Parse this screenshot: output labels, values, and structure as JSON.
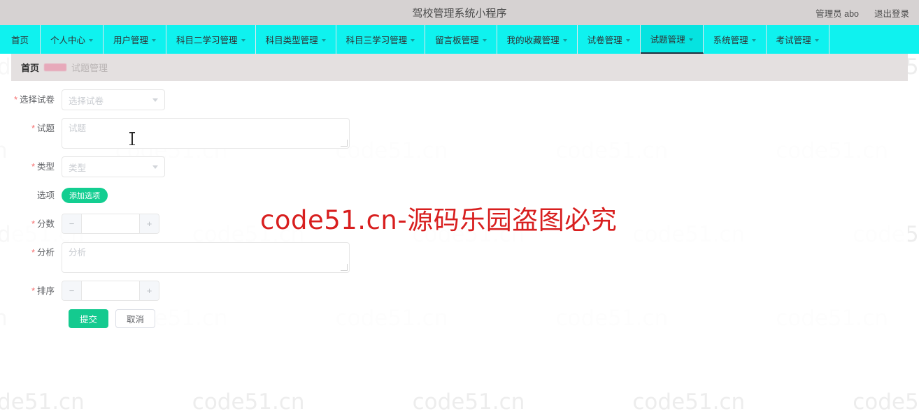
{
  "header": {
    "title": "驾校管理系统小程序",
    "user_label": "管理员 abo",
    "logout_label": "退出登录"
  },
  "nav": {
    "items": [
      {
        "label": "首页",
        "has_caret": false,
        "active": false
      },
      {
        "label": "个人中心",
        "has_caret": true,
        "active": false
      },
      {
        "label": "用户管理",
        "has_caret": true,
        "active": false
      },
      {
        "label": "科目二学习管理",
        "has_caret": true,
        "active": false
      },
      {
        "label": "科目类型管理",
        "has_caret": true,
        "active": false
      },
      {
        "label": "科目三学习管理",
        "has_caret": true,
        "active": false
      },
      {
        "label": "留言板管理",
        "has_caret": true,
        "active": false
      },
      {
        "label": "我的收藏管理",
        "has_caret": true,
        "active": false
      },
      {
        "label": "试卷管理",
        "has_caret": true,
        "active": false
      },
      {
        "label": "试题管理",
        "has_caret": true,
        "active": true
      },
      {
        "label": "系统管理",
        "has_caret": true,
        "active": false
      },
      {
        "label": "考试管理",
        "has_caret": true,
        "active": false
      }
    ]
  },
  "breadcrumb": {
    "home": "首页",
    "current": "试题管理"
  },
  "form": {
    "select_paper": {
      "label": "选择试卷",
      "required": true,
      "value": "",
      "placeholder": "选择试卷"
    },
    "question": {
      "label": "试题",
      "required": true,
      "value": "",
      "placeholder": "试题"
    },
    "type": {
      "label": "类型",
      "required": true,
      "value": "",
      "placeholder": "类型"
    },
    "options": {
      "label": "选项",
      "required": false,
      "add_button_label": "添加选项"
    },
    "score": {
      "label": "分数",
      "required": true,
      "value": "",
      "minus_label": "−",
      "plus_label": "+"
    },
    "analysis": {
      "label": "分析",
      "required": true,
      "value": "",
      "placeholder": "分析"
    },
    "sort": {
      "label": "排序",
      "required": true,
      "value": "",
      "minus_label": "−",
      "plus_label": "+"
    },
    "submit_label": "提交",
    "cancel_label": "取消"
  },
  "watermark": {
    "tile_text": "code51.cn",
    "red_notice": "code51.cn-源码乐园盗图必究"
  },
  "colors": {
    "nav_background": "#0ff2ef",
    "nav_active": "#06e3e0",
    "header_background": "#d6d2d2",
    "primary_green": "#14ca8f",
    "accent_green": "#13ce91",
    "required_red": "#f56c6c",
    "notice_red": "#d81f1f",
    "watermark_gray": "#ededed"
  }
}
